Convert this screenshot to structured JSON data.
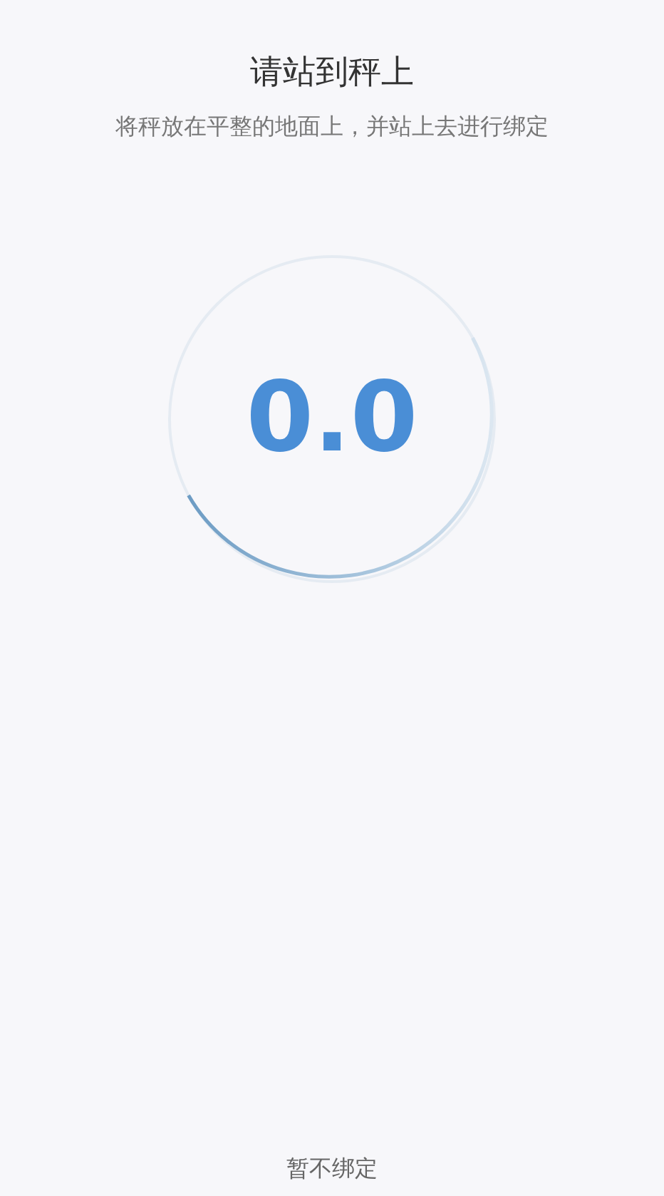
{
  "title": "请站到秤上",
  "subtitle": "将秤放在平整的地面上，并站上去进行绑定",
  "weight": "0.0",
  "skip_button": "暂不绑定"
}
